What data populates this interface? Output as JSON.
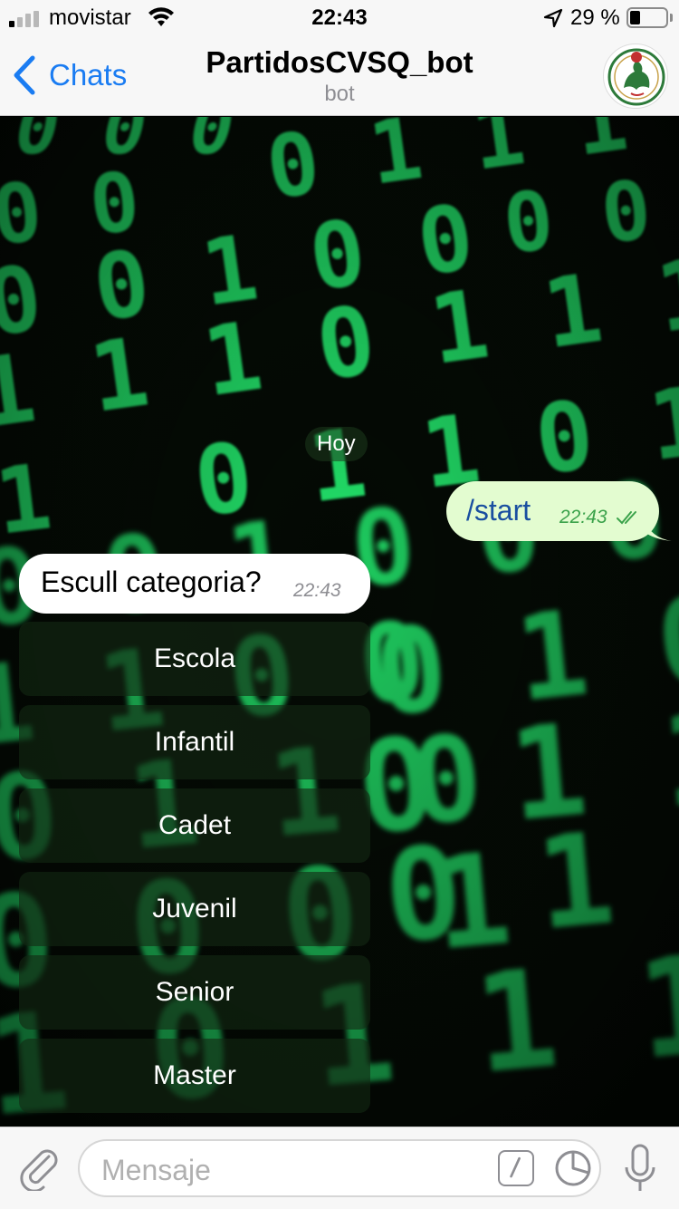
{
  "status_bar": {
    "carrier": "movistar",
    "time": "22:43",
    "battery_percent": "29 %",
    "signal_bars_active": 1,
    "signal_bars_total": 4,
    "battery_level": 0.29
  },
  "nav_bar": {
    "back_label": "Chats",
    "title": "PartidosCVSQ_bot",
    "subtitle": "bot"
  },
  "chat": {
    "date_separator": "Hoy",
    "outgoing": {
      "text": "/start",
      "time": "22:43",
      "status": "read"
    },
    "incoming": {
      "text": "Escull categoria?",
      "time": "22:43"
    },
    "keyboard_buttons": [
      "Escola",
      "Infantil",
      "Cadet",
      "Juvenil",
      "Senior",
      "Master"
    ]
  },
  "input_bar": {
    "placeholder": "Mensaje"
  },
  "colors": {
    "accent": "#1a7cf2",
    "outgoing_bubble": "#e3fcd0",
    "matrix_green": "#22e36a"
  },
  "icons": [
    "signal-icon",
    "wifi-icon",
    "location-arrow-icon",
    "battery-icon",
    "chevron-left-icon",
    "paperclip-icon",
    "slash-command-icon",
    "sticker-icon",
    "microphone-icon",
    "double-check-icon"
  ]
}
